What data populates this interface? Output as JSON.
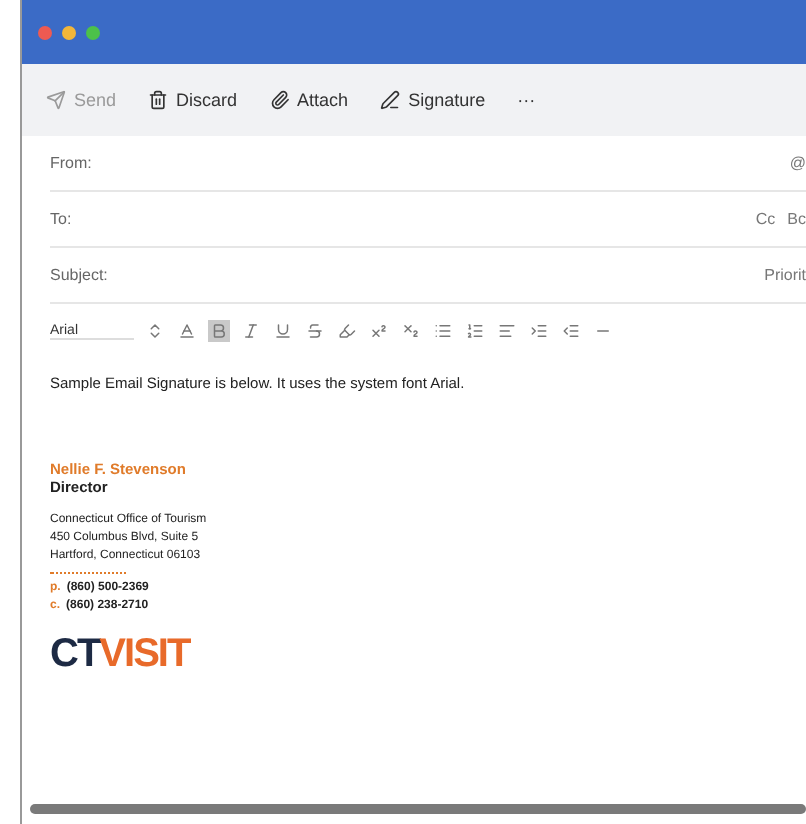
{
  "window": {
    "title_bar_controls": [
      {
        "color": "#ee5a52"
      },
      {
        "color": "#f2b63a"
      },
      {
        "color": "#4cc14a"
      }
    ]
  },
  "toolbar": [
    {
      "kind": "send",
      "label": "Send",
      "disabled": true
    },
    {
      "kind": "discard",
      "label": "Discard",
      "disabled": false
    },
    {
      "kind": "attach",
      "label": "Attach",
      "disabled": false
    },
    {
      "kind": "signature",
      "label": "Signature",
      "disabled": false
    },
    {
      "kind": "more",
      "label": "···",
      "disabled": false
    }
  ],
  "header_fields": [
    {
      "label": "From:",
      "extras": [
        "@"
      ]
    },
    {
      "label": "To:",
      "extras": [
        "Cc",
        "Bc"
      ]
    },
    {
      "label": "Subject:",
      "extras": [
        "Priorit"
      ]
    }
  ],
  "format_bar": {
    "font": "Arial",
    "buttons": [
      {
        "kind": "size",
        "selected": false
      },
      {
        "kind": "color",
        "selected": false
      },
      {
        "kind": "bold",
        "selected": true
      },
      {
        "kind": "italic",
        "selected": false
      },
      {
        "kind": "underline",
        "selected": false
      },
      {
        "kind": "strike",
        "selected": false
      },
      {
        "kind": "highlight",
        "selected": false
      },
      {
        "kind": "sup",
        "selected": false
      },
      {
        "kind": "sub",
        "selected": false
      },
      {
        "kind": "bullets",
        "selected": false
      },
      {
        "kind": "numbers",
        "selected": false
      },
      {
        "kind": "align",
        "selected": false
      },
      {
        "kind": "indent",
        "selected": false
      },
      {
        "kind": "outdent",
        "selected": false
      },
      {
        "kind": "rule",
        "selected": false
      }
    ]
  },
  "body": {
    "intro": "Sample Email Signature is below. It uses the system font Arial.",
    "signature": {
      "name": "Nellie F. Stevenson",
      "role": "Director",
      "address": [
        "Connecticut Office of Tourism",
        "450 Columbus Blvd, Suite 5",
        "Hartford, Connecticut 06103"
      ],
      "phones": [
        {
          "prefix": "p.",
          "number": "(860) 500-2369"
        },
        {
          "prefix": "c.",
          "number": "(860) 238-2710"
        }
      ],
      "logo": {
        "part_1": "CT",
        "part_2": "VISIT"
      }
    }
  }
}
